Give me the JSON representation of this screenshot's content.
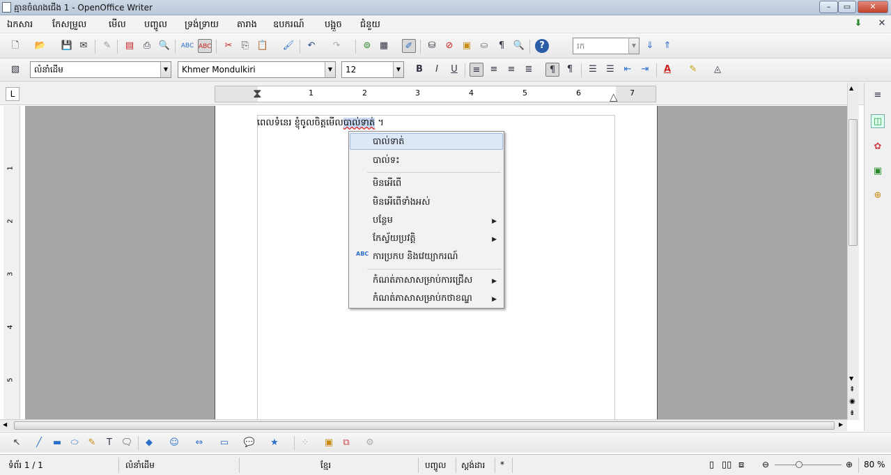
{
  "window": {
    "title": "គ្មានចំណងជើង 1 - OpenOffice Writer",
    "controls": {
      "minimize": "–",
      "maximize": "▭",
      "close": "✕"
    }
  },
  "menubar": {
    "items": [
      "ឯកសារ",
      "កែសម្រួល",
      "មើល",
      "បញ្ចូល",
      "ទ្រង់ទ្រាយ",
      "តារាង",
      "ឧបករណ៍",
      "បង្អួច",
      "ជំនួយ"
    ]
  },
  "find_box": {
    "placeholder": "រក"
  },
  "formatting": {
    "paragraph_style": "លំនាំដើម",
    "font_name": "Khmer Mondulkiri",
    "font_size": "12"
  },
  "ruler": {
    "labels": [
      "1",
      "2",
      "3",
      "4",
      "5",
      "6",
      "7"
    ],
    "vlabels": [
      "1",
      "2",
      "3",
      "4",
      "5"
    ]
  },
  "document": {
    "text_before": "ពេលទំនេរ ខ្ញុំចូលចិត្តមើល",
    "misspelled": "បាល់ទាត់",
    "text_after": " ។"
  },
  "context_menu": {
    "suggestion_1": "បាល់ទាត់",
    "suggestion_2": "បាល់ទះ",
    "ignore": "មិនអើពើ",
    "ignore_all": "មិនអើពើទាំងអស់",
    "add": "បន្ថែម",
    "autocorrect": "កែស្វ័យប្រវត្តិ",
    "spelling_grammar": "ការប្រកប និងវេយ្យាករណ៍",
    "spelling_icon_text": "ABC",
    "set_language_selection": "កំណត់ភាសាសម្រាប់ការជ្រើស",
    "set_language_paragraph": "កំណត់ភាសាសម្រាប់កថាខណ្ឌ"
  },
  "statusbar": {
    "page": "ទំព័រ 1 / 1",
    "style": "លំនាំដើម",
    "language": "ខ្មែរ",
    "insert_mode": "បញ្ចូល",
    "selection_mode": "ស្តង់ដារ",
    "modified": "*",
    "zoom": "80 %"
  },
  "colors": {
    "accent": "#2a6fc9",
    "highlight_menu": "#dde8f6",
    "document_bg": "#a6a6a6"
  }
}
